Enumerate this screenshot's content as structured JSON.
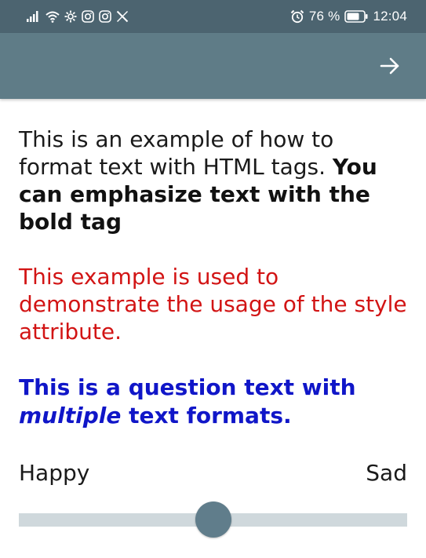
{
  "status_bar": {
    "battery_percent": "76 %",
    "time": "12:04",
    "left_icons": [
      "signal-icon",
      "wifi-icon",
      "settings-icon",
      "instagram-icon",
      "instagram-icon",
      "x-icon"
    ],
    "right_icons": [
      "alarm-icon",
      "battery-icon"
    ]
  },
  "app_bar": {
    "next_icon": "arrow-right-icon"
  },
  "content": {
    "para1_normal": "This is an example of how to format text with HTML tags. ",
    "para1_bold": "You can emphasize text with the bold tag",
    "para2": "This example is used to demonstrate the usage of the style attribute.",
    "question_part1": "This is a question text with ",
    "question_italic": "multiple",
    "question_part2": " text formats."
  },
  "scale": {
    "left_label": "Happy",
    "right_label": "Sad",
    "value": 0.5
  },
  "colors": {
    "status_bar": "#4c6470",
    "app_bar": "#5f7c87",
    "red_text": "#d21414",
    "blue_text": "#1016c8",
    "slider_track": "#cfd8dc",
    "slider_thumb": "#607d8b"
  }
}
